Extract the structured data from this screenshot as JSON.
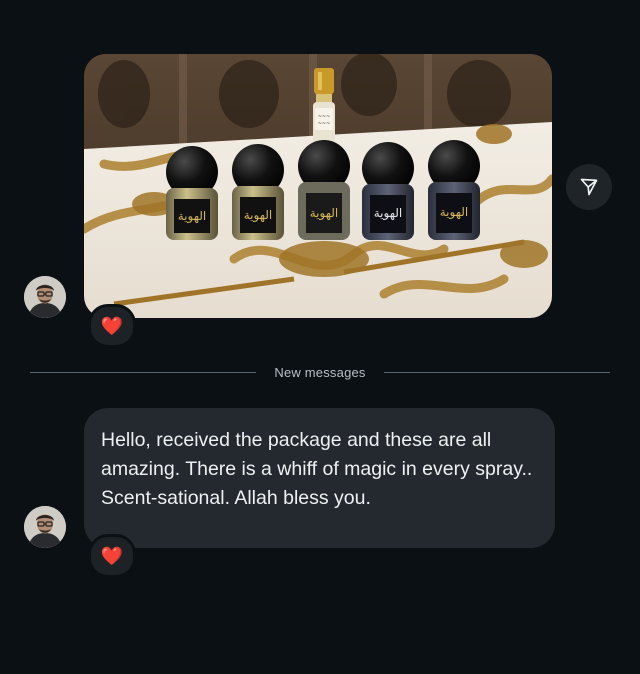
{
  "thread": {
    "divider_label": "New messages",
    "photo_message": {
      "image_alt": "Five black perfume bottles and a small oil bottle on a patterned tablecloth",
      "label_text": "الهوية",
      "reaction": "❤️"
    },
    "text_message": {
      "line1": "Hello, received the package and these are all amazing. There is a whiff of magic in every spray..",
      "line2": "Scent-sational. Allah bless you.",
      "reaction": "❤️"
    }
  },
  "icons": {
    "share": "paper-plane-icon",
    "avatar": "user-avatar"
  },
  "colors": {
    "background": "#0b1015",
    "bubble": "#24292f",
    "heart": "#e0182d",
    "divider": "#5a6470"
  }
}
